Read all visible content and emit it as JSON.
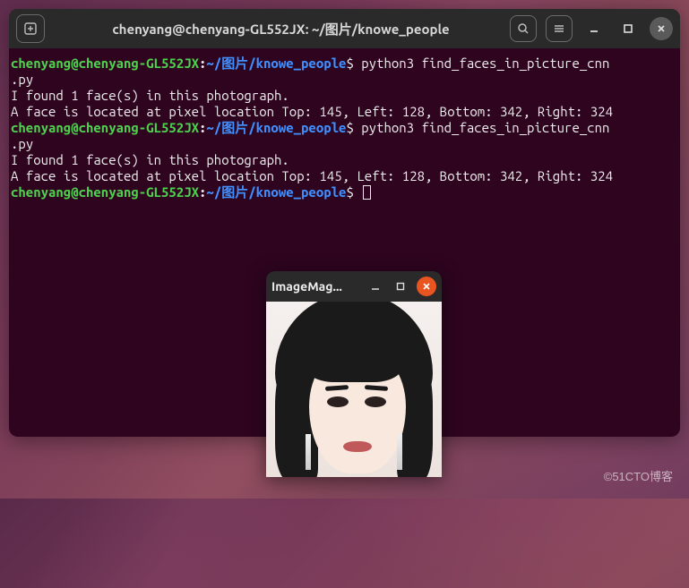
{
  "terminal": {
    "title": "chenyang@chenyang-GL552JX: ~/图片/knowe_people",
    "prompt": {
      "user_host": "chenyang@chenyang-GL552JX",
      "colon": ":",
      "path": "~/图片/knowe_people",
      "symbol": "$"
    },
    "runs": [
      {
        "command": " python3 find_faces_in_picture_cnn",
        "command_wrap": ".py",
        "out1": "I found 1 face(s) in this photograph.",
        "out2": "A face is located at pixel location Top: 145, Left: 128, Bottom: 342, Right: 324"
      },
      {
        "command": " python3 find_faces_in_picture_cnn",
        "command_wrap": ".py",
        "out1": "I found 1 face(s) in this photograph.",
        "out2": "A face is located at pixel location Top: 145, Left: 128, Bottom: 342, Right: 324"
      }
    ]
  },
  "image_window": {
    "title": "ImageMag..."
  },
  "watermark": "©51CTO博客",
  "icons": {
    "newtab": "new-tab-icon",
    "search": "search-icon",
    "menu": "menu-icon",
    "minimize": "minimize-icon",
    "maximize": "maximize-icon",
    "close": "close-icon"
  }
}
